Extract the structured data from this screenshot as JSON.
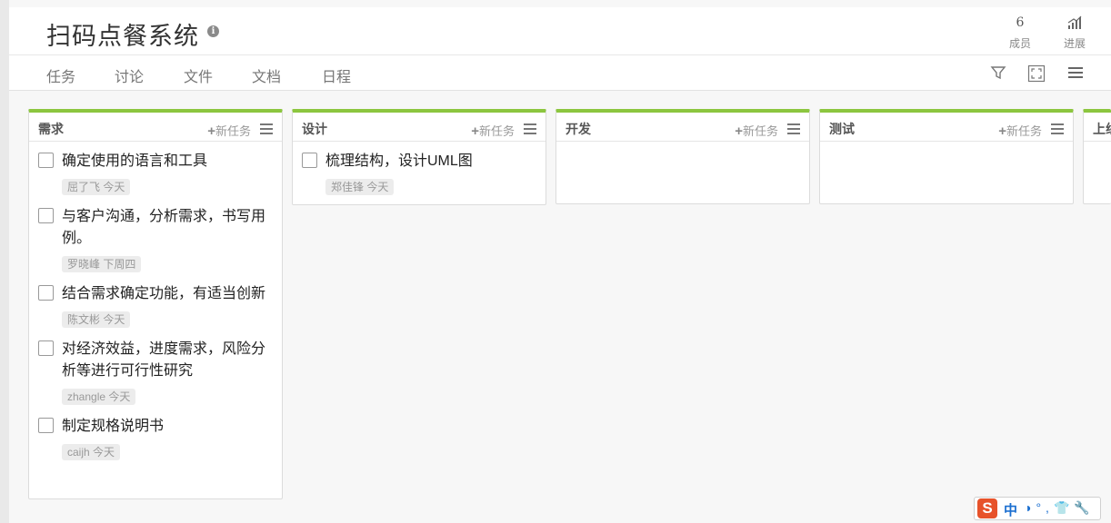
{
  "header": {
    "title": "扫码点餐系统",
    "info_icon": "i",
    "members_count": "6",
    "members_label": "成员",
    "progress_label": "进展"
  },
  "tabs": [
    {
      "label": "任务"
    },
    {
      "label": "讨论"
    },
    {
      "label": "文件"
    },
    {
      "label": "文档"
    },
    {
      "label": "日程"
    }
  ],
  "toolbar_icons": [
    "filter-icon",
    "fullscreen-icon",
    "menu-icon"
  ],
  "new_task_label": "新任务",
  "columns": [
    {
      "title": "需求",
      "tasks": [
        {
          "title": "确定使用的语言和工具",
          "meta": "屈了飞 今天"
        },
        {
          "title": "与客户沟通，分析需求，书写用例。",
          "meta": "罗晓峰 下周四"
        },
        {
          "title": "结合需求确定功能，有适当创新",
          "meta": "陈文彬 今天"
        },
        {
          "title": "对经济效益，进度需求，风险分析等进行可行性研究",
          "meta": "zhangle 今天"
        },
        {
          "title": "制定规格说明书",
          "meta": "caijh 今天"
        }
      ]
    },
    {
      "title": "设计",
      "tasks": [
        {
          "title": "梳理结构，设计UML图",
          "meta": "郑佳锋 今天"
        }
      ]
    },
    {
      "title": "开发",
      "tasks": []
    },
    {
      "title": "测试",
      "tasks": []
    },
    {
      "title": "上线",
      "tasks": []
    }
  ],
  "ime": {
    "logo": "S",
    "mode": "中",
    "glyphs": "◑°,👕🔧"
  },
  "colors": {
    "accent": "#8cc63f",
    "background": "#f7f7f7"
  }
}
